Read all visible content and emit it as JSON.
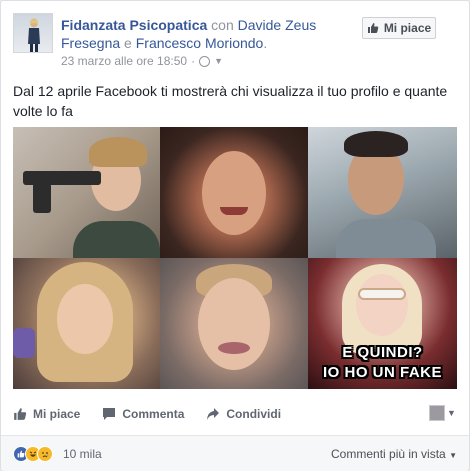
{
  "post": {
    "author": "Fidanzata Psicopatica",
    "with_word": "con",
    "tag1": "Davide Zeus Fresegna",
    "and_word": "e",
    "tag2": "Francesco Moriondo",
    "period": ".",
    "timestamp": "23 marzo alle ore 18:50",
    "separator": "·",
    "like_page_label": "Mi piace",
    "text": "Dal 12 aprile Facebook ti mostrerà chi visualizza il tuo profilo e quante volte lo fa"
  },
  "image": {
    "caption_line1": "E QUINDI?",
    "caption_line2": "IO HO UN FAKE"
  },
  "actions": {
    "like": "Mi piace",
    "comment": "Commenta",
    "share": "Condividi"
  },
  "footer": {
    "reaction_count": "10 mila",
    "sort_label": "Commenti più in vista"
  },
  "colors": {
    "link": "#365899",
    "like_blue": "#4267b2",
    "haha_yellow": "#f7b928"
  }
}
